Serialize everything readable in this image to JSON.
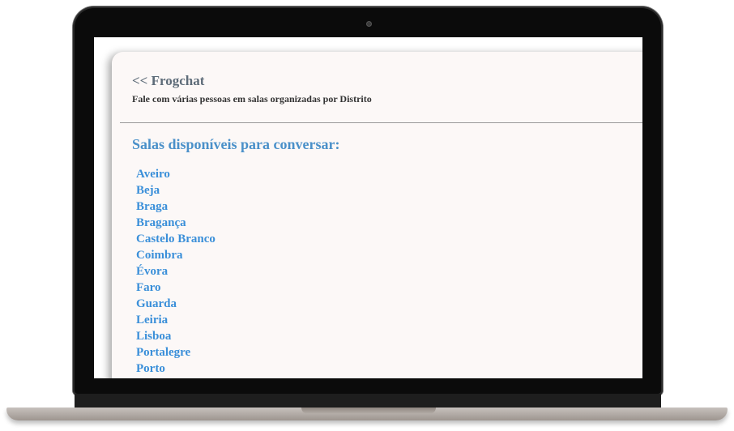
{
  "app": {
    "title": "<< Frogchat",
    "subtitle": "Fale com várias pessoas em salas organizadas por Distrito"
  },
  "rooms": {
    "heading": "Salas disponíveis para conversar:",
    "items": [
      "Aveiro",
      "Beja",
      "Braga",
      "Bragança",
      "Castelo Branco",
      "Coimbra",
      "Évora",
      "Faro",
      "Guarda",
      "Leiria",
      "Lisboa",
      "Portalegre",
      "Porto"
    ]
  }
}
